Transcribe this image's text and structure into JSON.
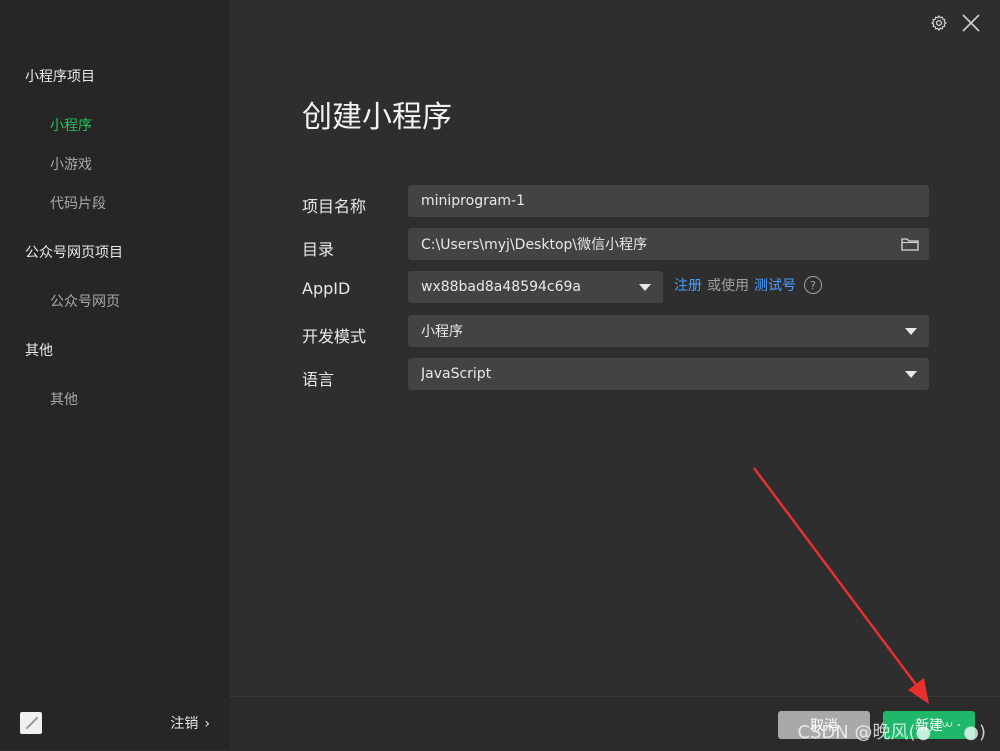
{
  "sidebar": {
    "sections": [
      {
        "title": "小程序项目",
        "items": [
          {
            "label": "小程序",
            "active": true
          },
          {
            "label": "小游戏",
            "active": false
          },
          {
            "label": "代码片段",
            "active": false
          }
        ]
      },
      {
        "title": "公众号网页项目",
        "items": [
          {
            "label": "公众号网页",
            "active": false
          }
        ]
      },
      {
        "title": "其他",
        "items": [
          {
            "label": "其他",
            "active": false
          }
        ]
      }
    ],
    "logout_label": "注销",
    "logout_chevron": "›"
  },
  "header": {
    "settings_icon": "gear-icon",
    "close_icon": "close-icon"
  },
  "main": {
    "title": "创建小程序",
    "form": {
      "project_name": {
        "label": "项目名称",
        "value": "miniprogram-1"
      },
      "directory": {
        "label": "目录",
        "value": "C:\\Users\\myj\\Desktop\\微信小程序"
      },
      "appid": {
        "label": "AppID",
        "value": "wx88bad8a48594c69a"
      },
      "dev_mode": {
        "label": "开发模式",
        "value": "小程序"
      },
      "language": {
        "label": "语言",
        "value": "JavaScript"
      }
    },
    "appid_links": {
      "register": "注册",
      "or_use": "或使用",
      "test_account": "测试号",
      "help": "?"
    }
  },
  "footer": {
    "cancel_label": "取消",
    "create_label": "新建"
  },
  "watermark": "CSDN @晚风(●˙꒳˙●)",
  "colors": {
    "accent_green": "#22c35e",
    "link_blue": "#4a9eff",
    "annotation_red": "#e8302e"
  }
}
